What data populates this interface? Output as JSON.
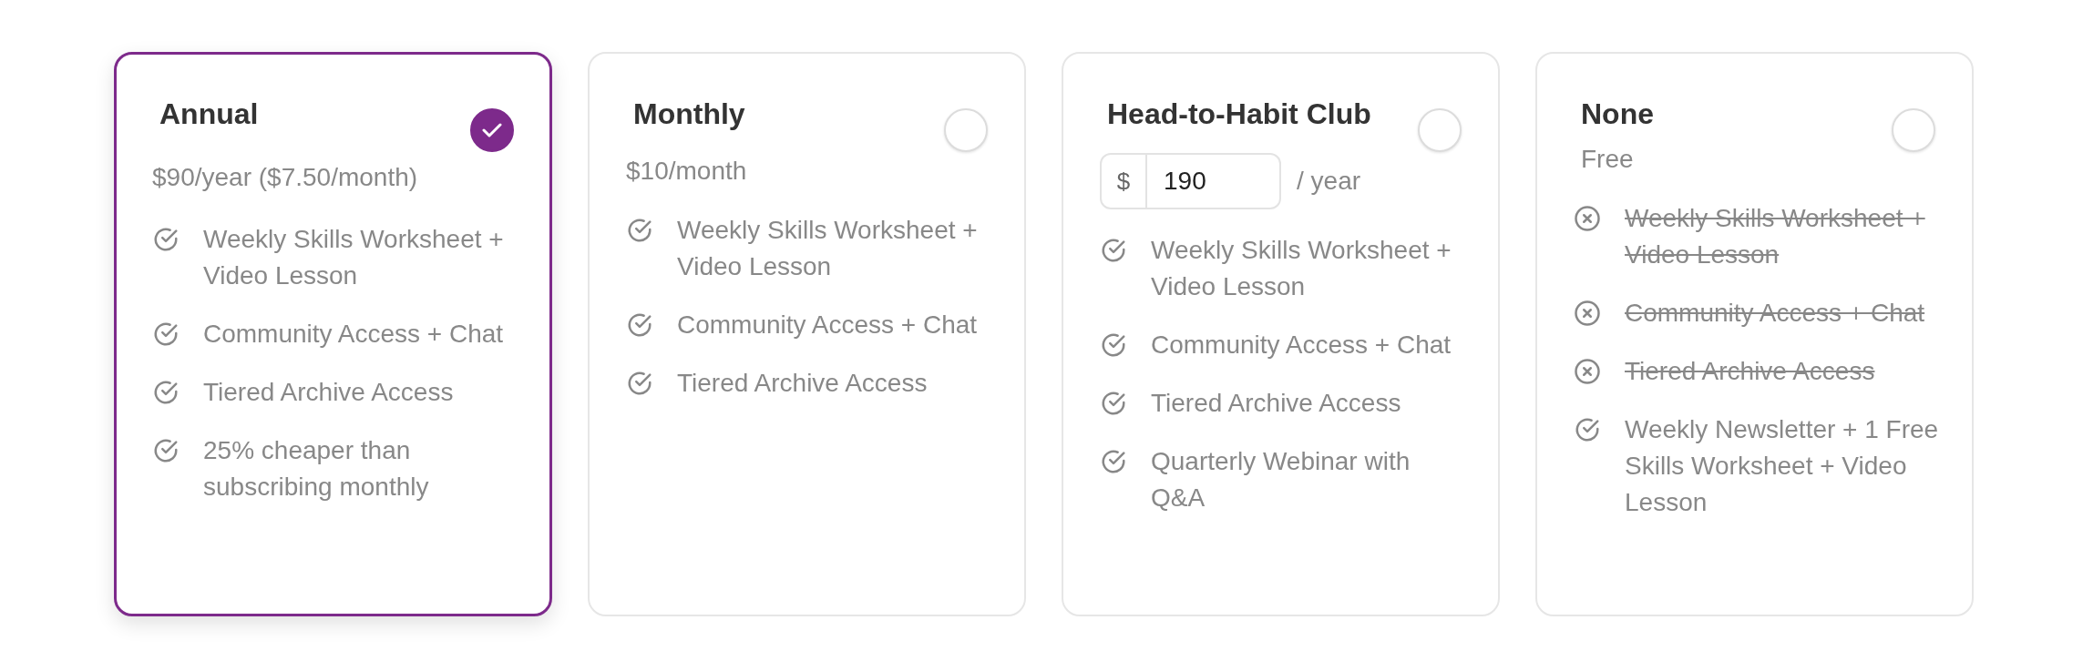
{
  "plans": [
    {
      "title": "Annual",
      "selected": true,
      "price": "$90/year ($7.50/month)",
      "features": [
        {
          "text": "Weekly Skills Worksheet + Video Lesson",
          "included": true
        },
        {
          "text": "Community Access + Chat",
          "included": true
        },
        {
          "text": "Tiered Archive Access",
          "included": true
        },
        {
          "text": "25% cheaper than subscribing monthly",
          "included": true
        }
      ]
    },
    {
      "title": "Monthly",
      "selected": false,
      "price": "$10/month",
      "features": [
        {
          "text": "Weekly Skills Worksheet + Video Lesson",
          "included": true
        },
        {
          "text": "Community Access + Chat",
          "included": true
        },
        {
          "text": "Tiered Archive Access",
          "included": true
        }
      ]
    },
    {
      "title": "Head-to-Habit Club",
      "selected": false,
      "price_input": {
        "prefix": "$",
        "value": "190",
        "suffix": "/ year"
      },
      "features": [
        {
          "text": "Weekly Skills Worksheet + Video Lesson",
          "included": true
        },
        {
          "text": "Community Access + Chat",
          "included": true
        },
        {
          "text": "Tiered Archive Access",
          "included": true
        },
        {
          "text": "Quarterly Webinar with Q&A",
          "included": true
        }
      ]
    },
    {
      "title": "None",
      "selected": false,
      "subtitle": "Free",
      "features": [
        {
          "text": "Weekly Skills Worksheet + Video Lesson",
          "included": false
        },
        {
          "text": "Community Access + Chat",
          "included": false
        },
        {
          "text": "Tiered Archive Access",
          "included": false
        },
        {
          "text": "Weekly Newsletter + 1 Free Skills Worksheet + Video Lesson",
          "included": true
        }
      ]
    }
  ]
}
